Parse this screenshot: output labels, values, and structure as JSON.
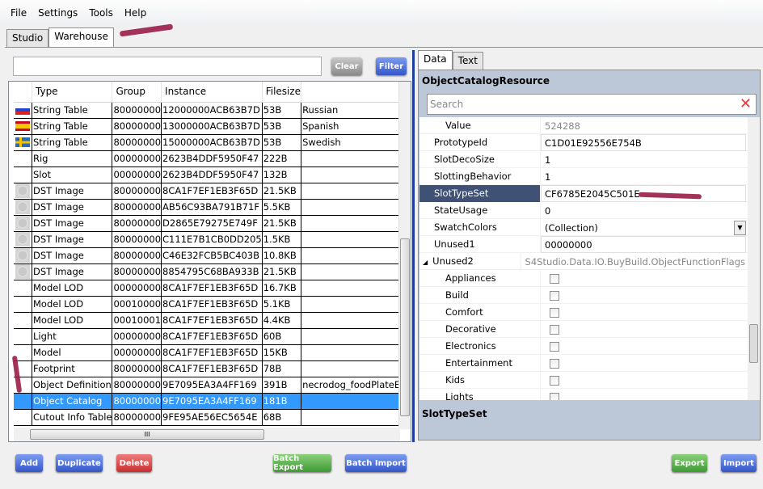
{
  "menu": [
    "File",
    "Settings",
    "Tools",
    "Help"
  ],
  "tabs": [
    "Studio",
    "Warehouse"
  ],
  "filter": {
    "value": "",
    "clear_label": "Clear",
    "filter_label": "Filter"
  },
  "table": {
    "columns": [
      "Type",
      "Group",
      "Instance",
      "Filesize",
      ""
    ],
    "rows": [
      {
        "icon": "flag-russia",
        "type": "String Table",
        "group": "80000000",
        "instance": "12000000ACB63B7D",
        "size": "53B",
        "name": "Russian"
      },
      {
        "icon": "flag-spain",
        "type": "String Table",
        "group": "80000000",
        "instance": "13000000ACB63B7D",
        "size": "53B",
        "name": "Spanish"
      },
      {
        "icon": "flag-sweden",
        "type": "String Table",
        "group": "80000000",
        "instance": "15000000ACB63B7D",
        "size": "53B",
        "name": "Swedish"
      },
      {
        "icon": "",
        "type": "Rig",
        "group": "00000000",
        "instance": "2623B4DDF5950F47",
        "size": "222B",
        "name": ""
      },
      {
        "icon": "",
        "type": "Slot",
        "group": "00000000",
        "instance": "2623B4DDF5950F47",
        "size": "132B",
        "name": ""
      },
      {
        "icon": "thumb",
        "type": "DST Image",
        "group": "80000000",
        "instance": "8CA1F7EF1EB3F65D",
        "size": "21.5KB",
        "name": ""
      },
      {
        "icon": "thumb",
        "type": "DST Image",
        "group": "80000000",
        "instance": "AB56C93BA791B71F",
        "size": "5.5KB",
        "name": ""
      },
      {
        "icon": "thumb",
        "type": "DST Image",
        "group": "80000000",
        "instance": "D2865E79275E749F",
        "size": "21.5KB",
        "name": ""
      },
      {
        "icon": "thumb",
        "type": "DST Image",
        "group": "80000000",
        "instance": "C111E7B1CB0DD205",
        "size": "1.5KB",
        "name": ""
      },
      {
        "icon": "thumb",
        "type": "DST Image",
        "group": "80000000",
        "instance": "C46E32FCB5BC403B",
        "size": "10.8KB",
        "name": ""
      },
      {
        "icon": "thumb",
        "type": "DST Image",
        "group": "80000000",
        "instance": "8854795C68BA933B",
        "size": "21.5KB",
        "name": ""
      },
      {
        "icon": "",
        "type": "Model LOD",
        "group": "00000000",
        "instance": "8CA1F7EF1EB3F65D",
        "size": "16.7KB",
        "name": ""
      },
      {
        "icon": "",
        "type": "Model LOD",
        "group": "00010000",
        "instance": "8CA1F7EF1EB3F65D",
        "size": "5.1KB",
        "name": ""
      },
      {
        "icon": "",
        "type": "Model LOD",
        "group": "00010001",
        "instance": "8CA1F7EF1EB3F65D",
        "size": "4.4KB",
        "name": ""
      },
      {
        "icon": "",
        "type": "Light",
        "group": "00000000",
        "instance": "8CA1F7EF1EB3F65D",
        "size": "60B",
        "name": ""
      },
      {
        "icon": "",
        "type": "Model",
        "group": "00000000",
        "instance": "8CA1F7EF1EB3F65D",
        "size": "15KB",
        "name": ""
      },
      {
        "icon": "",
        "type": "Footprint",
        "group": "80000000",
        "instance": "8CA1F7EF1EB3F65D",
        "size": "78B",
        "name": ""
      },
      {
        "icon": "",
        "type": "Object Definition",
        "group": "80000000",
        "instance": "9E7095EA3A4FF169",
        "size": "391B",
        "name": "necrodog_foodPlateEatSin"
      },
      {
        "icon": "",
        "type": "Object Catalog",
        "group": "80000000",
        "instance": "9E7095EA3A4FF169",
        "size": "181B",
        "name": "",
        "selected": true
      },
      {
        "icon": "",
        "type": "Cutout Info Table",
        "group": "80000000",
        "instance": "9FE95AE56EC5654E",
        "size": "68B",
        "name": ""
      }
    ]
  },
  "right": {
    "tabs": [
      "Data",
      "Text"
    ],
    "title": "ObjectCatalogResource",
    "search_placeholder": "Search",
    "properties": [
      {
        "name": "Value",
        "value": "524288",
        "indent": true,
        "readonly": true
      },
      {
        "name": "PrototypeId",
        "value": "C1D01E92556E754B",
        "box": true
      },
      {
        "name": "SlotDecoSize",
        "value": "1"
      },
      {
        "name": "SlottingBehavior",
        "value": "1"
      },
      {
        "name": "SlotTypeSet",
        "value": "CF6785E2045C501E",
        "box": true,
        "selected": true
      },
      {
        "name": "StateUsage",
        "value": "0"
      },
      {
        "name": "SwatchColors",
        "value": "(Collection)",
        "dropdown": true
      },
      {
        "name": "Unused1",
        "value": "00000000",
        "box": true
      },
      {
        "name": "Unused2",
        "value": "S4Studio.Data.IO.BuyBuild.ObjectFunctionFlags",
        "expanded": true,
        "readonly": true
      }
    ],
    "flags": [
      "Appliances",
      "Build",
      "Comfort",
      "Decorative",
      "Electronics",
      "Entertainment",
      "Kids",
      "Lights"
    ],
    "description": "SlotTypeSet"
  },
  "buttons": {
    "add": "Add",
    "duplicate": "Duplicate",
    "delete": "Delete",
    "batch_export": "Batch Export",
    "batch_import": "Batch Import",
    "export": "Export",
    "import": "Import"
  }
}
